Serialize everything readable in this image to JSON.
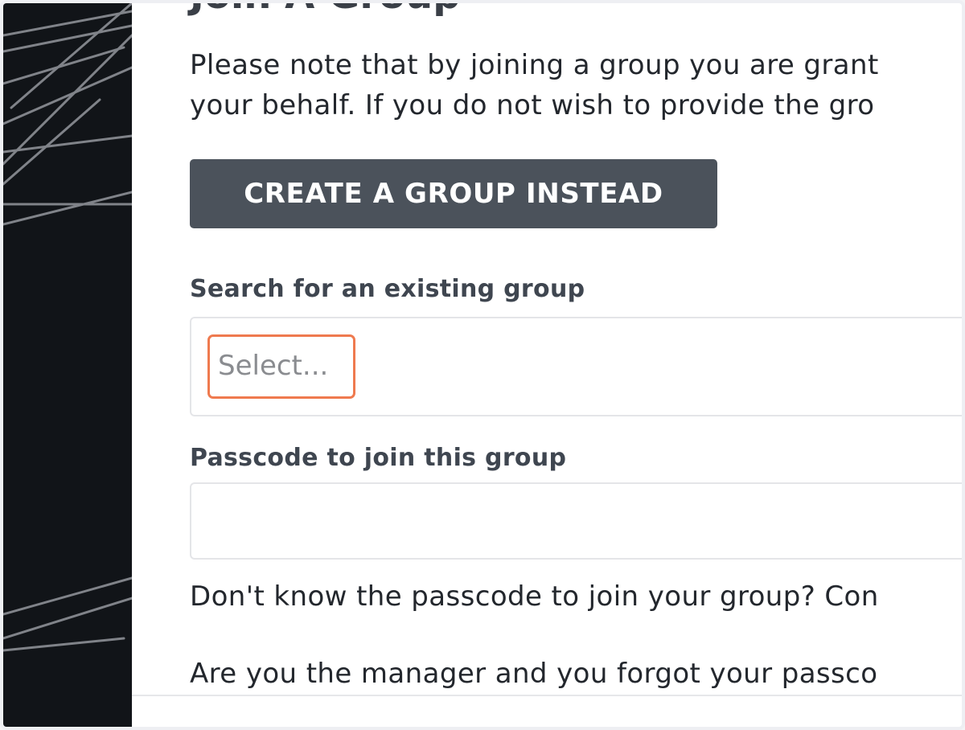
{
  "page": {
    "title": "Join A Group",
    "intro_line_1": "Please note that by joining a group you are grant",
    "intro_line_2": "your behalf. If you do not wish to provide the gro"
  },
  "actions": {
    "create_group_label": "CREATE A GROUP INSTEAD"
  },
  "search": {
    "label": "Search for an existing group",
    "placeholder": "Select..."
  },
  "passcode": {
    "label": "Passcode to join this group",
    "value": ""
  },
  "help": {
    "line_1": "Don't know the passcode to join your group? Con",
    "line_2": "Are you the manager and you forgot your passco"
  },
  "colors": {
    "sidebar_bg": "#111418",
    "button_bg": "#4b525b",
    "focus_outline": "#ef7a4f",
    "text": "#23272d"
  }
}
